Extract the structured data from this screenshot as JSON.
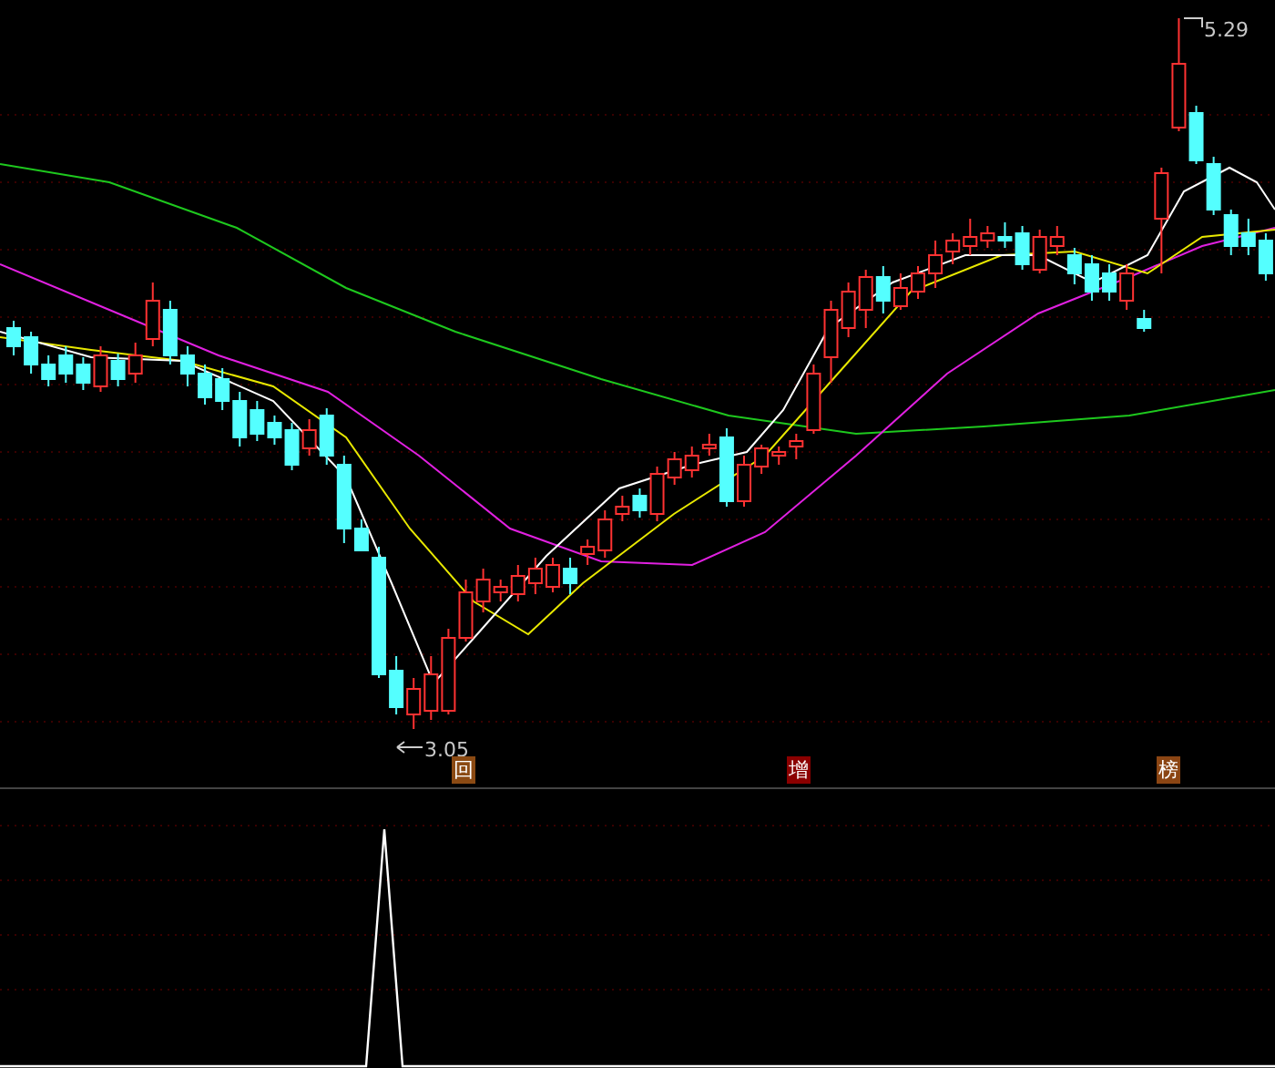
{
  "price_chart": {
    "high_label": "5.29",
    "low_label": "3.05"
  },
  "signals": [
    {
      "label": "回",
      "color": "#8b4a13"
    },
    {
      "label": "增",
      "color": "#8b0000"
    },
    {
      "label": "榜",
      "color": "#8b4513"
    }
  ]
}
